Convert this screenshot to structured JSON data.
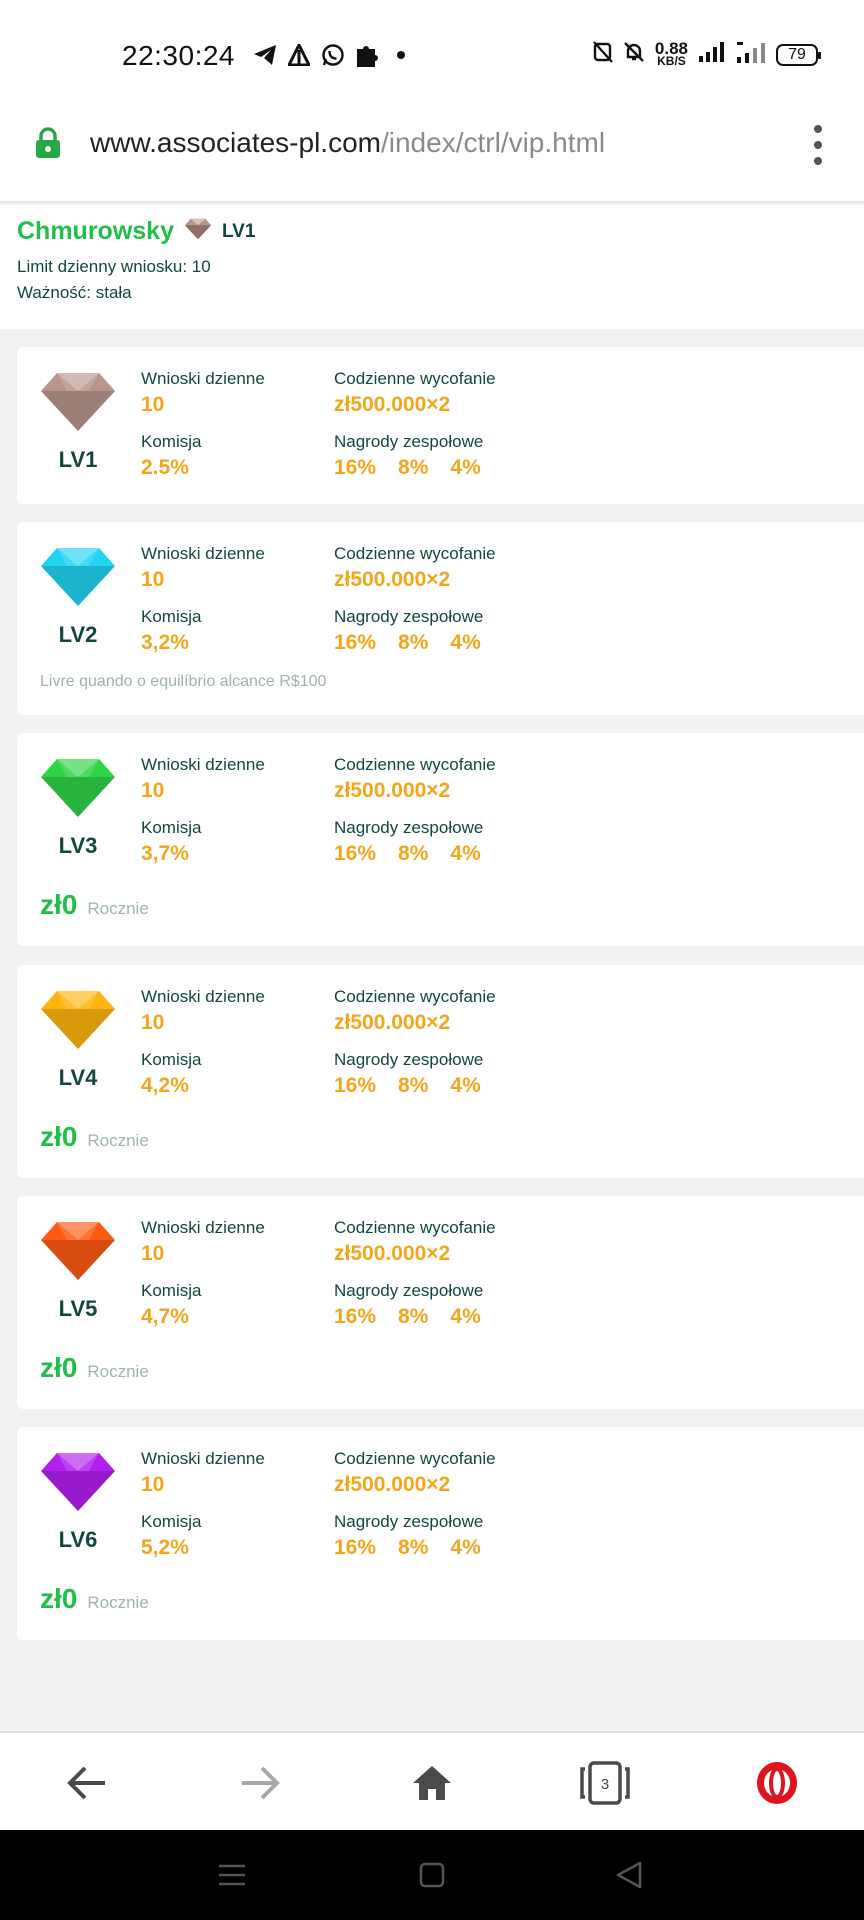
{
  "status_bar": {
    "time": "22:30:24",
    "left_icons": [
      "telegram-icon",
      "delta-icon",
      "whatsapp-icon",
      "puzzle-icon",
      "dot-icon"
    ],
    "nfc_icon": "nfc-off-icon",
    "mute_icon": "bell-off-icon",
    "speed_value": "0.88",
    "speed_unit": "KB/S",
    "signal_icons": [
      "signal-icon",
      "lte-signal-icon"
    ],
    "battery": "79"
  },
  "browser": {
    "url_domain": "www.associates-pl.com",
    "url_path": "/index/ctrl/vip.html",
    "lock_color": "#27a845"
  },
  "user": {
    "name": "Chmurowsky",
    "level": "LV1",
    "daily_limit": "Limit dzienny wniosku: 10",
    "validity": "Ważność: stała"
  },
  "labels": {
    "daily_requests": "Wnioski dzienne",
    "daily_withdrawal": "Codzienne wycofanie",
    "commission": "Komisja",
    "team_rewards": "Nagrody zespołowe"
  },
  "vip_levels": [
    {
      "level": "LV1",
      "gem_color": "#b8968b",
      "daily_requests": "10",
      "withdrawal": "zł500.000×2",
      "commission": "2.5%",
      "rewards": [
        "16%",
        "8%",
        "4%"
      ]
    },
    {
      "level": "LV2",
      "gem_color": "#22d3f2",
      "daily_requests": "10",
      "withdrawal": "zł500.000×2",
      "commission": "3,2%",
      "rewards": [
        "16%",
        "8%",
        "4%"
      ],
      "note": "Livre quando o equilíbrio alcance R$100"
    },
    {
      "level": "LV3",
      "gem_color": "#2fd447",
      "daily_requests": "10",
      "withdrawal": "zł500.000×2",
      "commission": "3,7%",
      "rewards": [
        "16%",
        "8%",
        "4%"
      ],
      "price": "zł0",
      "period": "Rocznie"
    },
    {
      "level": "LV4",
      "gem_color": "#ffb410",
      "daily_requests": "10",
      "withdrawal": "zł500.000×2",
      "commission": "4,2%",
      "rewards": [
        "16%",
        "8%",
        "4%"
      ],
      "price": "zł0",
      "period": "Rocznie"
    },
    {
      "level": "LV5",
      "gem_color": "#ff5a14",
      "daily_requests": "10",
      "withdrawal": "zł500.000×2",
      "commission": "4,7%",
      "rewards": [
        "16%",
        "8%",
        "4%"
      ],
      "price": "zł0",
      "period": "Rocznie"
    },
    {
      "level": "LV6",
      "gem_color": "#b31ff0",
      "daily_requests": "10",
      "withdrawal": "zł500.000×2",
      "commission": "5,2%",
      "rewards": [
        "16%",
        "8%",
        "4%"
      ],
      "price": "zł0",
      "period": "Rocznie"
    }
  ],
  "bottom_nav": {
    "back_icon": "back-arrow-icon",
    "forward_icon": "forward-arrow-icon",
    "home_icon": "home-icon",
    "tabs_count": "3",
    "browser_icon": "opera-icon"
  },
  "colors": {
    "accent_green": "#1fbf4a",
    "value_orange": "#f3a61b",
    "label_dark": "#124640",
    "opera_red": "#e0141f"
  }
}
